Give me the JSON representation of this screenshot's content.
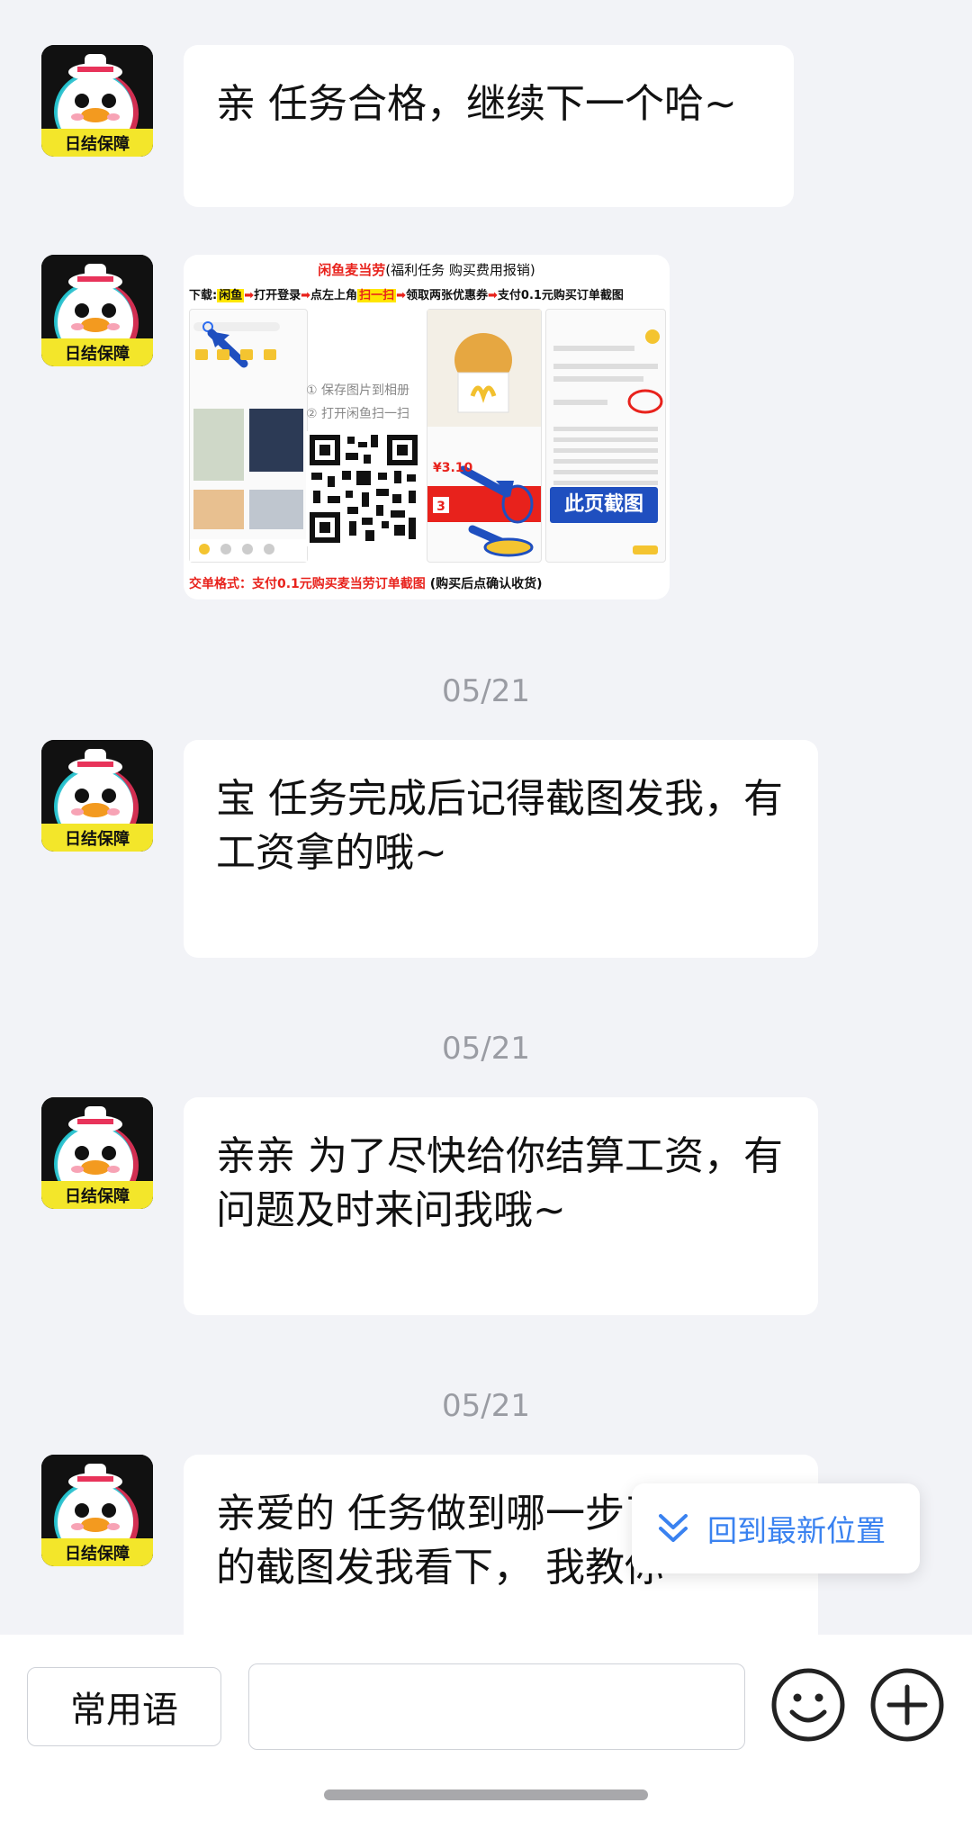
{
  "avatar": {
    "label": "日结保障"
  },
  "messages": [
    {
      "text": "亲 任务合格，继续下一个哈~"
    },
    {
      "text": "宝 任务完成后记得截图发我，有工资拿的哦~"
    },
    {
      "text": "亲亲 为了尽快给你结算工资，有问题及时来问我哦~"
    },
    {
      "text": "亲爱的 任务做到哪一步了，不会的截图发我看下， 我教你"
    }
  ],
  "dates": [
    "05/21",
    "05/21",
    "05/21"
  ],
  "image_card": {
    "title": "闲鱼麦当劳",
    "subtitle": "(福利任务 购买费用报销)",
    "step_prefix": "下载:",
    "step_app": "闲鱼",
    "step_open": "打开登录",
    "step_tap": "点左上角",
    "step_scan": "扫一扫",
    "step_coupon": "领取两张优惠券",
    "step_pay": "支付0.1元购买订单截图",
    "note_save": "① 保存图片到相册",
    "note_scan": "② 打开闲鱼扫一扫",
    "price": "¥3.10",
    "screenshot_tag": "此页截图",
    "footer_label": "交单格式：支付0.1元购买麦当劳订单截图",
    "footer_note": "(购买后点确认收货)"
  },
  "back_to_latest": {
    "label": "回到最新位置"
  },
  "input_bar": {
    "phrases_label": "常用语",
    "input_value": "",
    "emoji_icon": "smiley-icon",
    "plus_icon": "plus-circle-icon"
  }
}
